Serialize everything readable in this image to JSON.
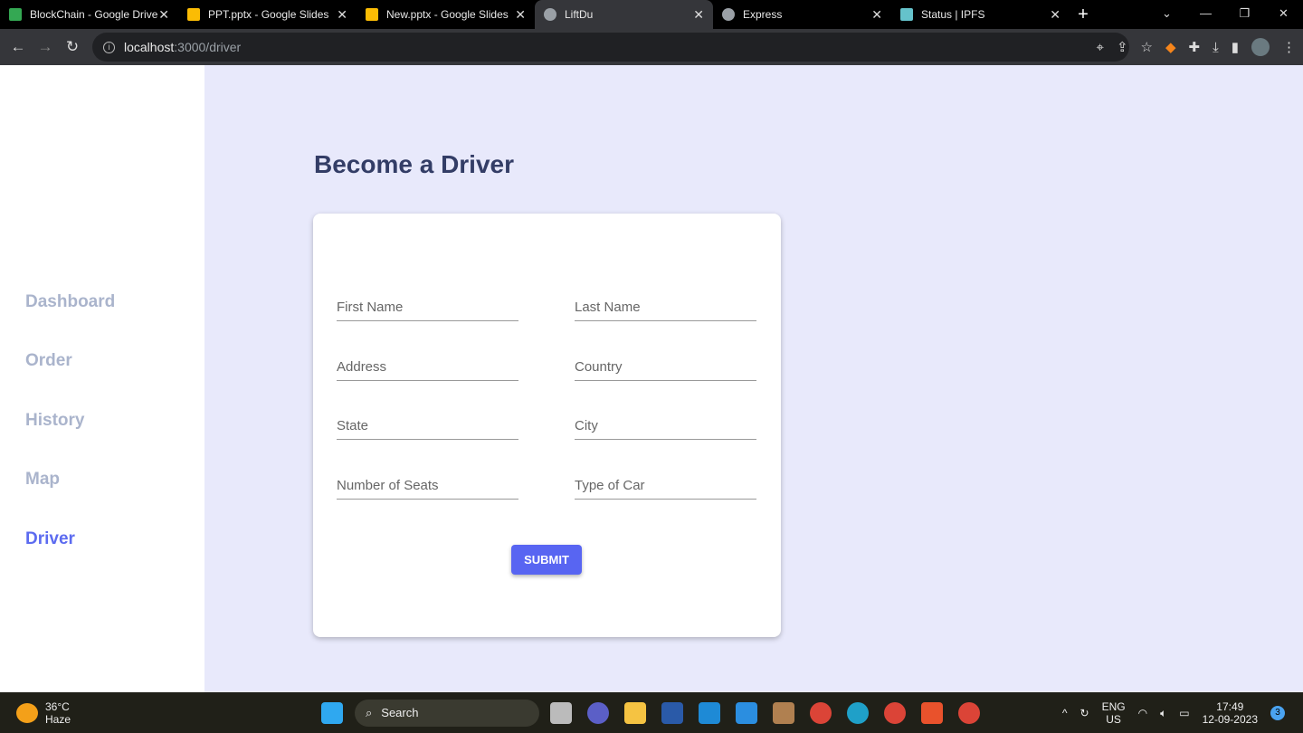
{
  "browser": {
    "tabs": [
      {
        "title": "BlockChain - Google Drive",
        "icon": "google-drive-icon",
        "color": "#34a853"
      },
      {
        "title": "PPT.pptx - Google Slides",
        "icon": "google-slides-icon",
        "color": "#fbbc04"
      },
      {
        "title": "New.pptx - Google Slides",
        "icon": "google-slides-icon",
        "color": "#fbbc04"
      },
      {
        "title": "LiftDu",
        "icon": "globe-icon",
        "color": "#9aa0a6",
        "active": true
      },
      {
        "title": "Express",
        "icon": "globe-icon",
        "color": "#9aa0a6"
      },
      {
        "title": "Status | IPFS",
        "icon": "ipfs-icon",
        "color": "#65c2cb"
      }
    ],
    "url_host": "localhost",
    "url_path": ":3000/driver"
  },
  "sidebar": {
    "items": [
      {
        "label": "Dashboard"
      },
      {
        "label": "Order"
      },
      {
        "label": "History"
      },
      {
        "label": "Map"
      },
      {
        "label": "Driver",
        "active": true
      }
    ]
  },
  "page": {
    "title": "Become a Driver"
  },
  "form": {
    "fields": [
      {
        "placeholder": "First Name"
      },
      {
        "placeholder": "Last Name"
      },
      {
        "placeholder": "Address"
      },
      {
        "placeholder": "Country"
      },
      {
        "placeholder": "State"
      },
      {
        "placeholder": "City"
      },
      {
        "placeholder": "Number of Seats"
      },
      {
        "placeholder": "Type of Car"
      }
    ],
    "submit_label": "SUBMIT"
  },
  "colors": {
    "accent": "#5865f2",
    "background": "#e8e9fb",
    "sidebar_active": "#5c6bf0"
  },
  "taskbar": {
    "temperature": "36°C",
    "weather": "Haze",
    "search_label": "Search",
    "lang": "ENG",
    "region": "US",
    "time": "17:49",
    "date": "12-09-2023",
    "notifications": "3"
  }
}
